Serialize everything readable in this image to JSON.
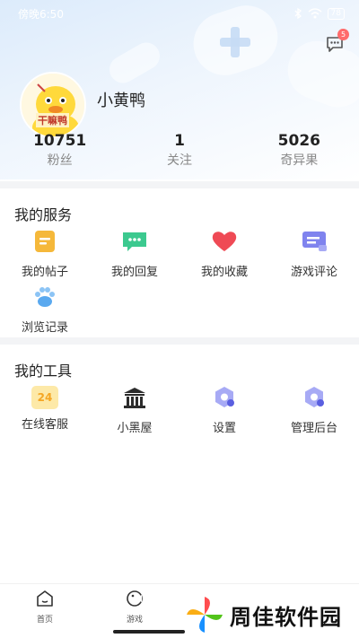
{
  "status_bar": {
    "time": "傍晚6:50",
    "battery": "78"
  },
  "messages": {
    "badge": "5"
  },
  "profile": {
    "name": "小黄鸭",
    "avatar_text": "干嘛鸭",
    "stats": [
      {
        "value": "10751",
        "label": "粉丝"
      },
      {
        "value": "1",
        "label": "关注"
      },
      {
        "value": "5026",
        "label": "奇异果"
      }
    ]
  },
  "services": {
    "title": "我的服务",
    "items": [
      {
        "label": "我的帖子",
        "icon": "post-icon",
        "color": "#f5b83a"
      },
      {
        "label": "我的回复",
        "icon": "reply-icon",
        "color": "#3cc98f"
      },
      {
        "label": "我的收藏",
        "icon": "heart-icon",
        "color": "#ef4a55"
      },
      {
        "label": "游戏评论",
        "icon": "comment-icon",
        "color": "#7f83ee"
      },
      {
        "label": "浏览记录",
        "icon": "paw-icon",
        "color": "#5aa9ef"
      }
    ]
  },
  "tools": {
    "title": "我的工具",
    "items": [
      {
        "label": "在线客服",
        "icon": "service-24-icon",
        "color": "#f5c23a",
        "badge": "24"
      },
      {
        "label": "小黑屋",
        "icon": "jail-icon",
        "color": "#2c2c2c"
      },
      {
        "label": "设置",
        "icon": "settings-icon",
        "color": "#7f83ee"
      },
      {
        "label": "管理后台",
        "icon": "admin-icon",
        "color": "#7f83ee"
      }
    ]
  },
  "tabbar": {
    "tabs": [
      {
        "label": "首页",
        "icon": "home-icon"
      },
      {
        "label": "游戏",
        "icon": "game-icon"
      }
    ]
  },
  "watermark": {
    "text": "周佳软件园"
  }
}
